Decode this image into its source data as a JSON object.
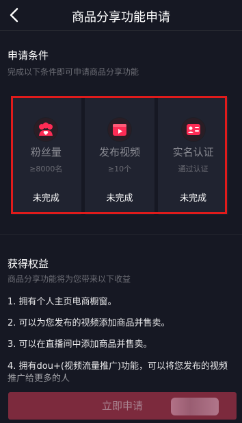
{
  "header": {
    "title": "商品分享功能申请"
  },
  "conditions": {
    "title": "申请条件",
    "subtitle": "完成以下条件即可申请商品分享功能",
    "cards": [
      {
        "name": "粉丝量",
        "requirement": "≥8000名",
        "status": "未完成",
        "icon": "fans-icon"
      },
      {
        "name": "发布视频",
        "requirement": "≥10个",
        "status": "未完成",
        "icon": "video-icon"
      },
      {
        "name": "实名认证",
        "requirement": "通过认证",
        "status": "未完成",
        "icon": "id-card-icon"
      }
    ]
  },
  "benefits": {
    "title": "获得权益",
    "subtitle": "商品分享功能将为您带来以下收益",
    "items": [
      "1. 拥有个人主页电商橱窗。",
      "2. 可以为您发布的视频添加商品并售卖。",
      "3. 可以在直播间中添加商品并售卖。",
      "4. 拥有dou+(视频流量推广)功能，可以将您发布的视频推广给更多的人"
    ]
  },
  "apply_button": {
    "label": "立即申请"
  },
  "colors": {
    "accent": "#fe2c55",
    "highlight": "#e01b1b",
    "background": "#161823"
  }
}
